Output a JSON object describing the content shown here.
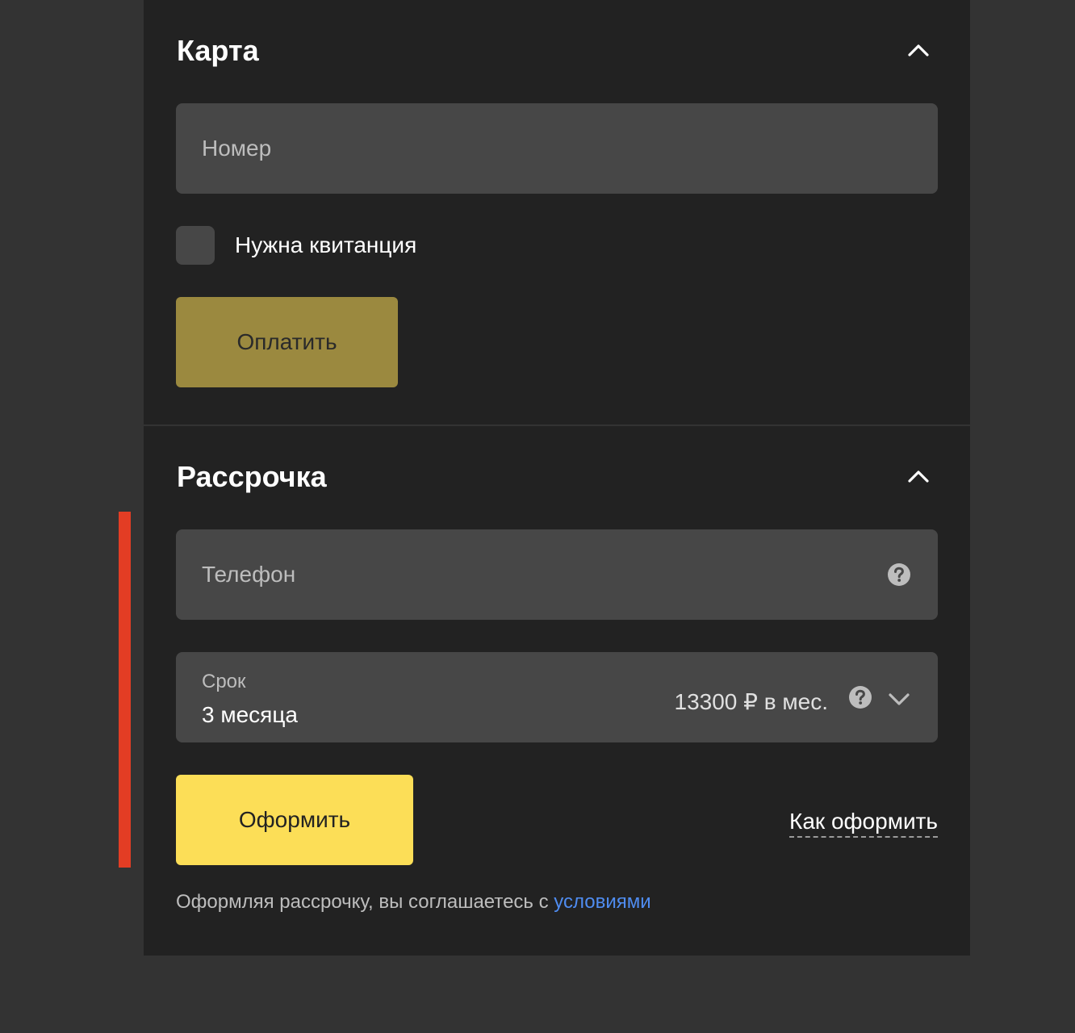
{
  "colors": {
    "background": "#333333",
    "panel": "#222222",
    "field": "#474747",
    "accent_bar": "#e33d24",
    "pay_button_bg": "#9b893f",
    "pay_button_text": "#2a2a2a",
    "apply_button_bg": "#fcde57",
    "apply_button_text": "#222222",
    "link": "#4f8cf0"
  },
  "card_section": {
    "title": "Карта",
    "collapse_icon": "chevron-up-icon",
    "number_placeholder": "Номер",
    "receipt_checkbox_label": "Нужна квитанция",
    "receipt_checked": false,
    "pay_button_label": "Оплатить"
  },
  "installment_section": {
    "title": "Рассрочка",
    "collapse_icon": "chevron-up-icon",
    "phone_placeholder": "Телефон",
    "phone_help_icon": "question-circle-icon",
    "term": {
      "label": "Срок",
      "value": "3 месяца",
      "monthly_amount": "13300 ₽ в мес.",
      "help_icon": "question-circle-icon",
      "dropdown_icon": "chevron-down-icon"
    },
    "apply_button_label": "Оформить",
    "how_to_link": "Как оформить",
    "legal_text": "Оформляя рассрочку, вы соглашаетесь с ",
    "legal_link": "условиями"
  }
}
